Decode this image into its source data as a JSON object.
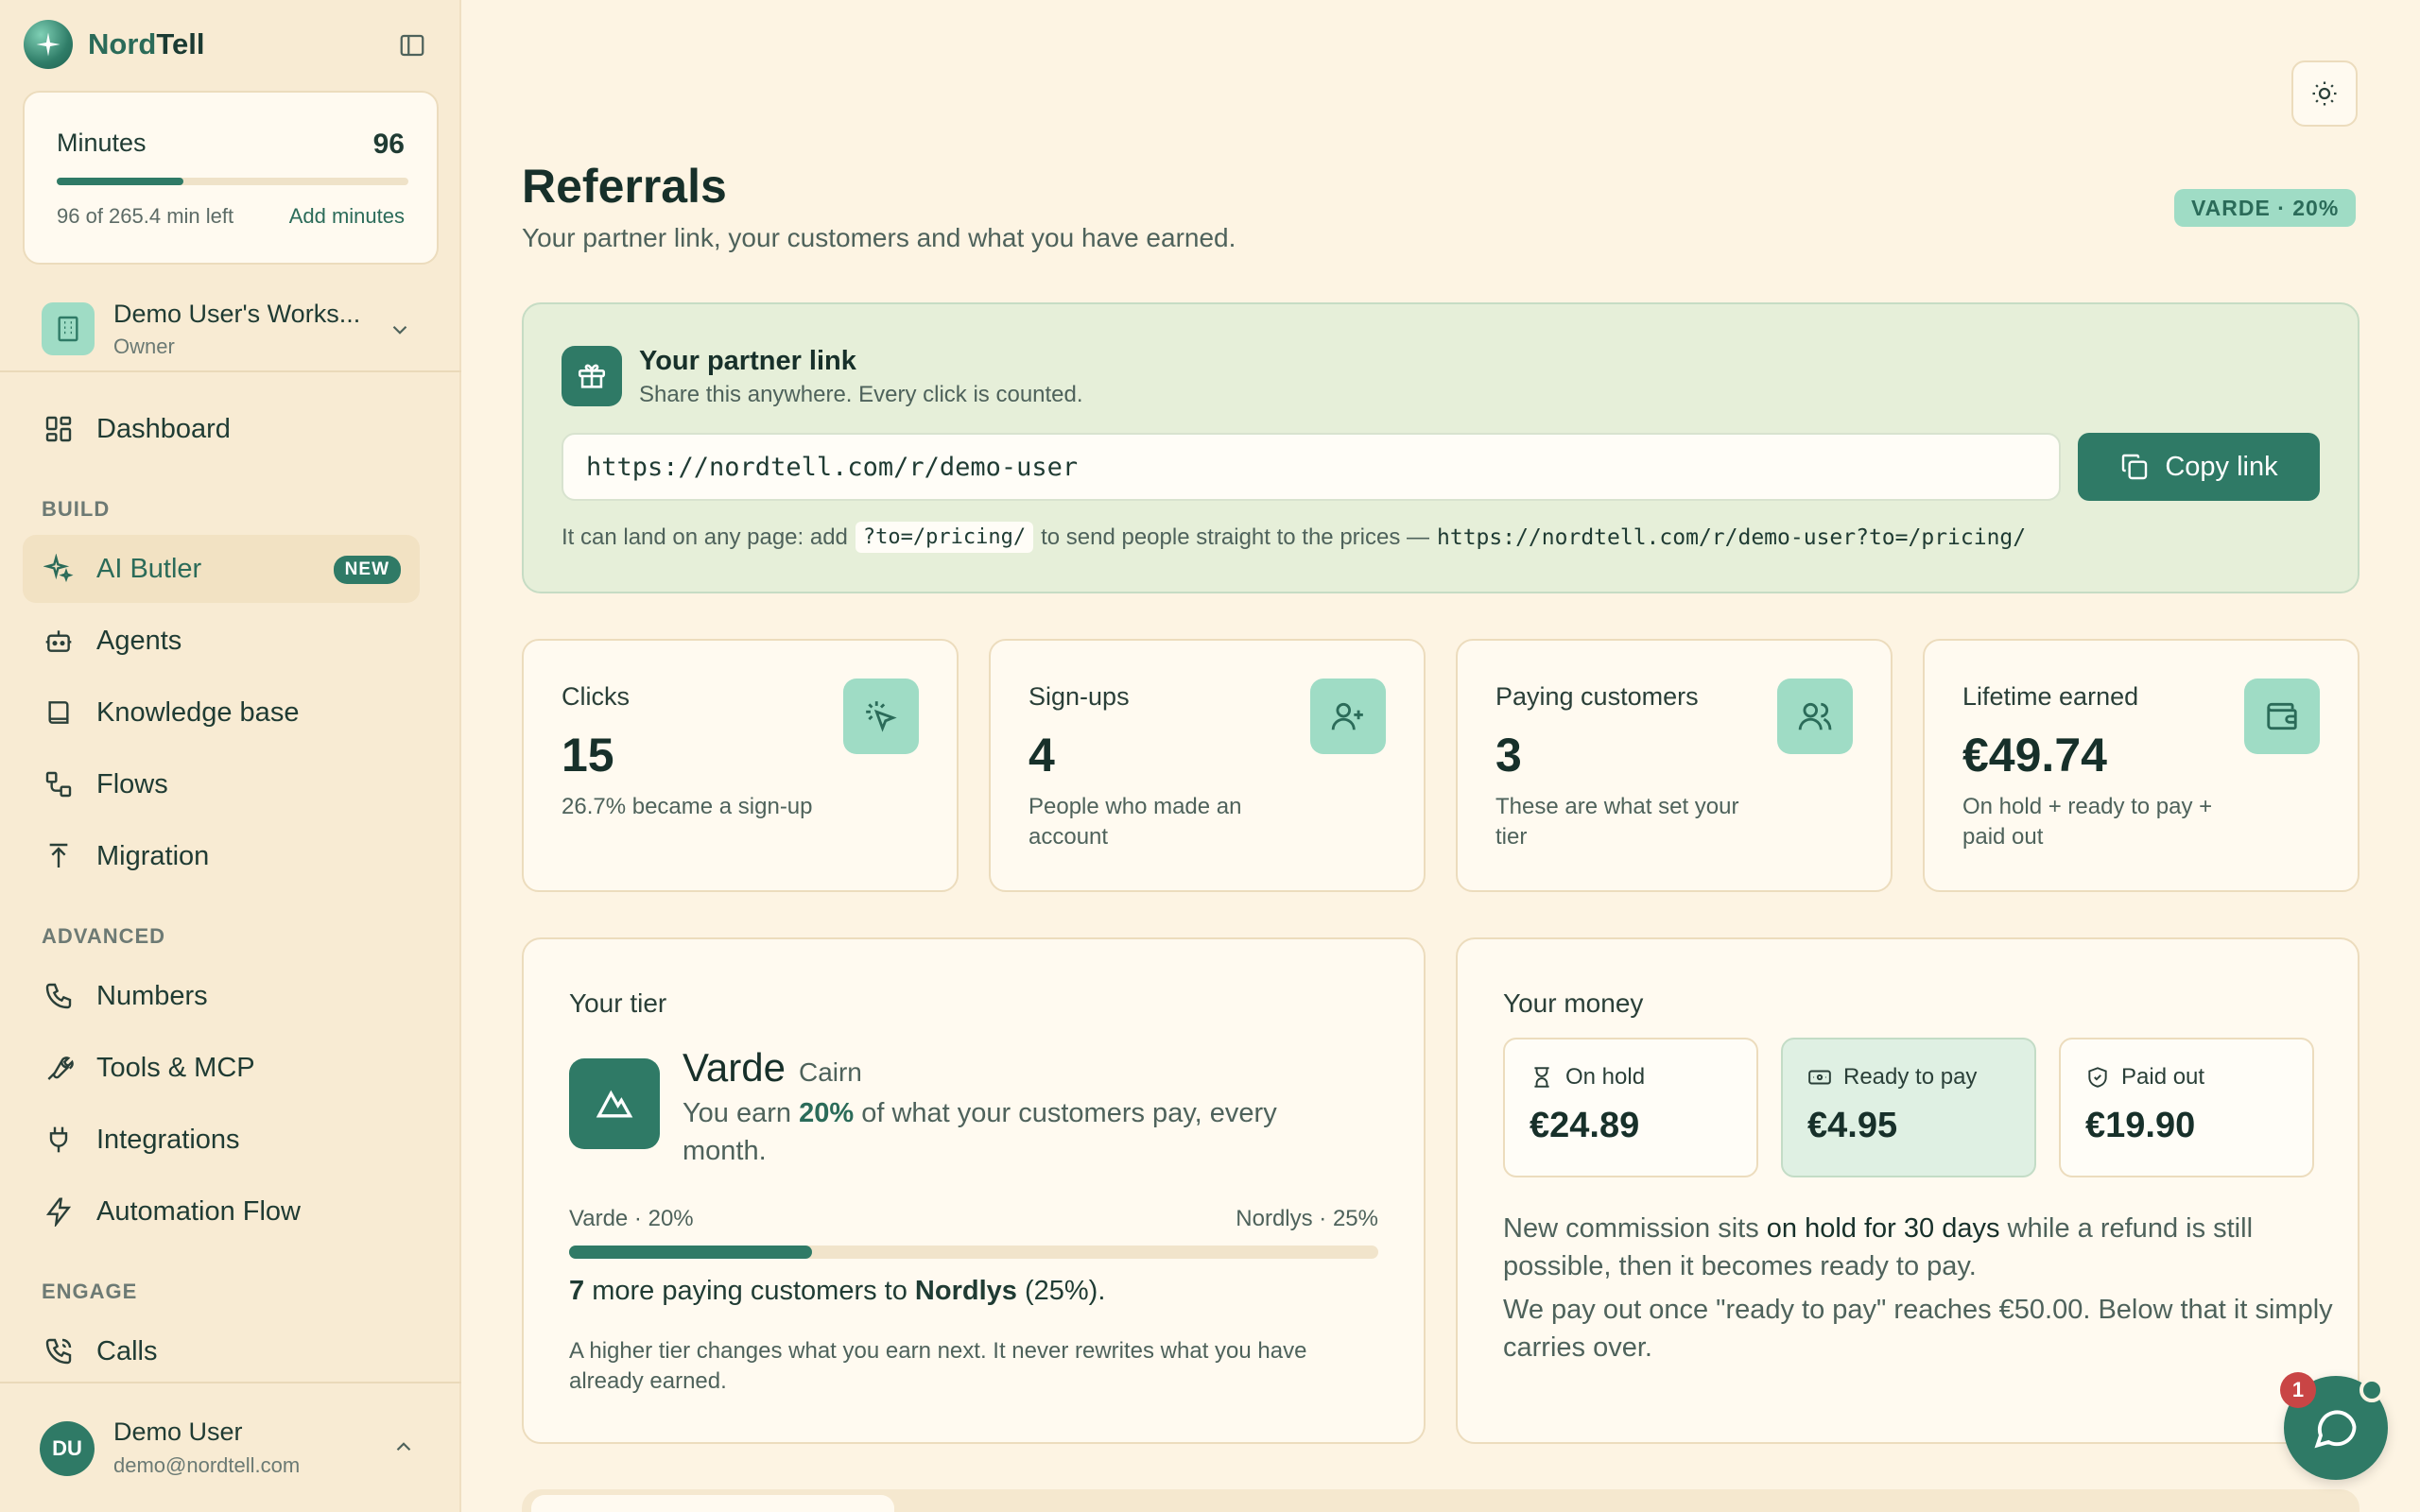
{
  "brand": {
    "name_part1": "Nord",
    "name_part2": "Tell"
  },
  "minutes": {
    "label": "Minutes",
    "value": "96",
    "left_text": "96 of 265.4 min left",
    "add_label": "Add minutes",
    "fraction_used": 0.36
  },
  "workspace": {
    "name": "Demo User's Works...",
    "role": "Owner"
  },
  "nav": {
    "dashboard": "Dashboard",
    "section_build": "BUILD",
    "ai_butler": "AI Butler",
    "ai_butler_badge": "NEW",
    "agents": "Agents",
    "knowledge_base": "Knowledge base",
    "flows": "Flows",
    "migration": "Migration",
    "section_advanced": "ADVANCED",
    "numbers": "Numbers",
    "tools": "Tools & MCP",
    "integrations": "Integrations",
    "automation": "Automation Flow",
    "section_engage": "ENGAGE",
    "calls": "Calls"
  },
  "user": {
    "initials": "DU",
    "name": "Demo User",
    "email": "demo@nordtell.com"
  },
  "page": {
    "title": "Referrals",
    "subtitle": "Your partner link, your customers and what you have earned.",
    "tier_badge": "VARDE · 20%"
  },
  "partner": {
    "title": "Your partner link",
    "subtitle": "Share this anywhere. Every click is counted.",
    "link": "https://nordtell.com/r/demo-user",
    "copy_label": "Copy link",
    "hint_prefix": "It can land on any page: add",
    "hint_param": "?to=/pricing/",
    "hint_middle": "to send people straight to the prices —",
    "hint_example": "https://nordtell.com/r/demo-user?to=/pricing/"
  },
  "stats": [
    {
      "label": "Clicks",
      "value": "15",
      "desc": "26.7% became a sign-up",
      "icon": "cursor-click-icon"
    },
    {
      "label": "Sign-ups",
      "value": "4",
      "desc": "People who made an account",
      "icon": "user-plus-icon"
    },
    {
      "label": "Paying customers",
      "value": "3",
      "desc": "These are what set your tier",
      "icon": "users-icon"
    },
    {
      "label": "Lifetime earned",
      "value": "€49.74",
      "desc": "On hold + ready to pay + paid out",
      "icon": "wallet-icon"
    }
  ],
  "tier": {
    "title": "Your tier",
    "name": "Varde",
    "alt": "Cairn",
    "earn_prefix": "You earn",
    "earn_pct": "20%",
    "earn_suffix": "of what your customers pay, every month.",
    "current": "Varde · 20%",
    "next": "Nordlys · 25%",
    "progress": 0.3,
    "more_count": "7",
    "more_middle": "more paying customers to",
    "more_tier": "Nordlys",
    "more_pct": "(25%).",
    "note": "A higher tier changes what you earn next. It never rewrites what you have already earned."
  },
  "money": {
    "title": "Your money",
    "on_hold_label": "On hold",
    "on_hold_value": "€24.89",
    "ready_label": "Ready to pay",
    "ready_value": "€4.95",
    "paid_label": "Paid out",
    "paid_value": "€19.90",
    "text1_prefix": "New commission sits",
    "text1_bold": "on hold for 30 days",
    "text1_suffix": "while a refund is still possible, then it becomes ready to pay.",
    "text2": "We pay out once \"ready to pay\" reaches €50.00. Below that it simply carries over."
  },
  "chat": {
    "count": "1"
  },
  "colors": {
    "accent": "#2f7a66",
    "mint": "#9fdcc5",
    "background": "#fdf4e3",
    "sidebar": "#f8ebd3",
    "danger": "#c94545"
  }
}
